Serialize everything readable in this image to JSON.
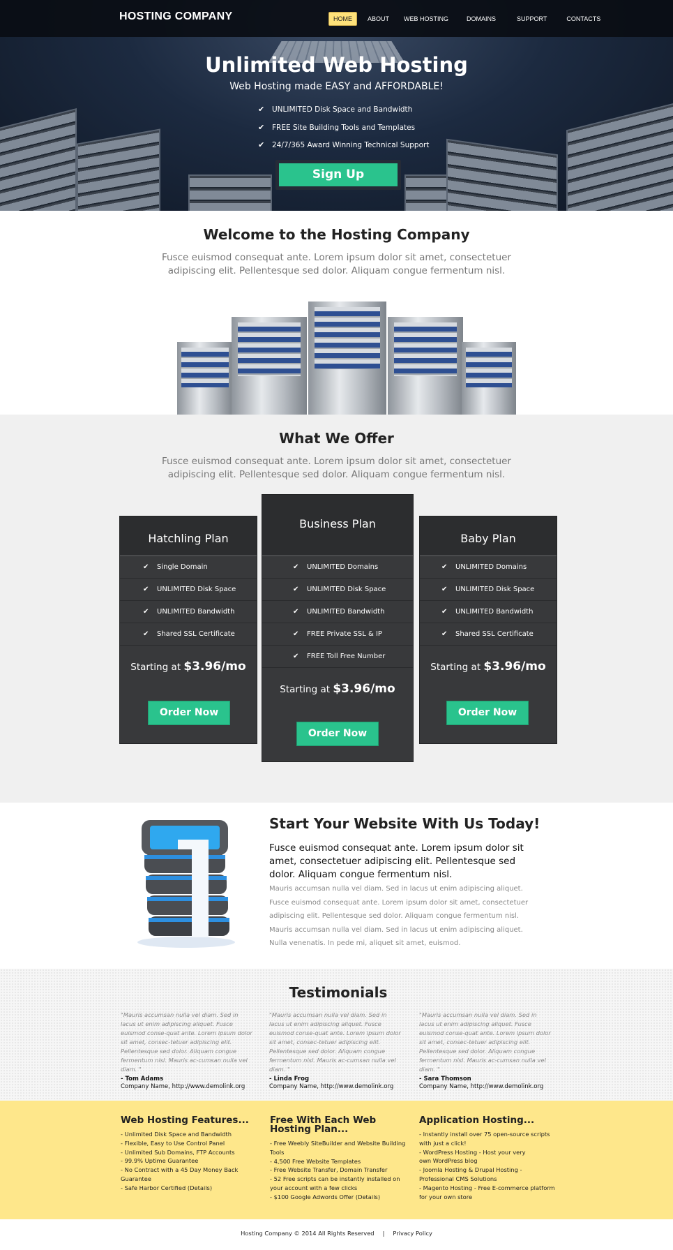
{
  "header": {
    "logo": "HOSTING COMPANY",
    "nav": [
      {
        "label": "HOME",
        "active": true
      },
      {
        "label": "ABOUT",
        "active": false
      },
      {
        "label": "WEB HOSTING",
        "active": false
      },
      {
        "label": "DOMAINS",
        "active": false
      },
      {
        "label": "SUPPORT",
        "active": false
      },
      {
        "label": "CONTACTS",
        "active": false
      }
    ]
  },
  "hero": {
    "title": "Unlimited Web Hosting",
    "subtitle": "Web Hosting made EASY and AFFORDABLE!",
    "features": [
      "UNLIMITED Disk Space and Bandwidth",
      "FREE Site Building Tools and Templates",
      "24/7/365 Award Winning Technical Support"
    ],
    "check_icon": "✔",
    "cta_label": "Sign Up"
  },
  "welcome": {
    "title": "Welcome to the Hosting Company",
    "text": "Fusce euismod consequat ante. Lorem ipsum dolor sit amet, consectetuer adipiscing elit. Pellentesque sed dolor. Aliquam congue fermentum nisl."
  },
  "offer": {
    "title": "What We Offer",
    "text": "Fusce euismod consequat ante. Lorem ipsum dolor sit amet, consectetuer adipiscing elit. Pellentesque sed dolor. Aliquam congue fermentum nisl.",
    "plans": [
      {
        "name": "Hatchling Plan",
        "features": [
          "Single Domain",
          "UNLIMITED Disk Space",
          "UNLIMITED Bandwidth",
          "Shared SSL Certificate"
        ],
        "price_prefix": "Starting at",
        "price": "$3.96/mo",
        "button": "Order Now"
      },
      {
        "name": "Business Plan",
        "features": [
          "UNLIMITED Domains",
          "UNLIMITED Disk Space",
          "UNLIMITED Bandwidth",
          "FREE Private SSL & IP",
          "FREE Toll Free Number"
        ],
        "price_prefix": "Starting at",
        "price": "$3.96/mo",
        "button": "Order Now"
      },
      {
        "name": "Baby Plan",
        "features": [
          "UNLIMITED Domains",
          "UNLIMITED Disk Space",
          "UNLIMITED Bandwidth",
          "Shared SSL Certificate"
        ],
        "price_prefix": "Starting at",
        "price": "$3.96/mo",
        "button": "Order Now"
      }
    ]
  },
  "start": {
    "title": "Start Your Website With Us Today!",
    "lead": "Fusce euismod consequat ante. Lorem ipsum dolor sit amet, consectetuer adipiscing elit. Pellentesque sed dolor. Aliquam congue fermentum nisl.",
    "body": "Mauris accumsan nulla vel diam. Sed in lacus ut enim adipiscing aliquet. Fusce euismod consequat ante. Lorem ipsum dolor sit amet, consectetuer adipiscing elit. Pellentesque sed dolor. Aliquam congue fermentum nisl. Mauris accumsan nulla vel diam. Sed in lacus ut enim adipiscing aliquet. Nulla venenatis. In pede mi, aliquet sit amet, euismod."
  },
  "testimonials": {
    "title": "Testimonials",
    "items": [
      {
        "quote": "\"Mauris accumsan nulla vel diam. Sed in lacus ut enim adipiscing aliquet. Fusce euismod conse-quat ante. Lorem ipsum dolor sit amet, consec-tetuer adipiscing elit. Pellentesque sed dolor. Aliquam congue fermentum nisl. Mauris ac-cumsan nulla vel diam. \"",
        "name": "- Tom Adams",
        "company": "Company Name, http://www.demolink.org"
      },
      {
        "quote": "\"Mauris accumsan nulla vel diam. Sed in lacus ut enim adipiscing aliquet. Fusce euismod conse-quat ante. Lorem ipsum dolor sit amet, consec-tetuer adipiscing elit. Pellentesque sed dolor. Aliquam congue fermentum nisl. Mauris ac-cumsan nulla vel diam. \"",
        "name": "- Linda Frog",
        "company": "Company Name, http://www.demolink.org"
      },
      {
        "quote": "\"Mauris accumsan nulla vel diam. Sed in lacus ut enim adipiscing aliquet. Fusce euismod conse-quat ante. Lorem ipsum dolor sit amet, consec-tetuer adipiscing elit. Pellentesque sed dolor. Aliquam congue fermentum nisl. Mauris ac-cumsan nulla vel diam. \"",
        "name": "- Sara Thomson",
        "company": "Company Name, http://www.demolink.org"
      }
    ]
  },
  "features": {
    "columns": [
      {
        "title": "Web Hosting Features...",
        "items": [
          "- Unlimited Disk Space and Bandwidth",
          "- Flexible, Easy to Use Control Panel",
          "- Unlimited Sub Domains, FTP Accounts",
          "- 99.9% Uptime Guarantee",
          "- No Contract with a 45 Day Money Back Guarantee",
          "- Safe Harbor Certified (Details)"
        ]
      },
      {
        "title": "Free With Each Web Hosting Plan...",
        "items": [
          "- Free Weebly SiteBuilder and Website Building Tools",
          "- 4,500 Free Website Templates",
          "- Free Website Transfer, Domain Transfer",
          "- 52 Free scripts can be instantly installed on your account with a few clicks",
          "- $100 Google Adwords Offer (Details)"
        ]
      },
      {
        "title": "Application Hosting...",
        "items": [
          "- Instantly install over 75 open-source scripts with just a click!",
          "- WordPress Hosting - Host your very own WordPress blog",
          "- Joomla Hosting & Drupal Hosting - Professional CMS Solutions",
          "- Magento Hosting - Free E-commerce platform  for your own store"
        ]
      }
    ]
  },
  "footer": {
    "copyright": "Hosting Company © 2014 All Rights Reserved",
    "separator": "|",
    "privacy": "Privacy Policy"
  },
  "colors": {
    "accent_green": "#2ac38d",
    "nav_active": "#ffe27a",
    "footer_band": "#fee78b",
    "plan_bg": "#38393b"
  }
}
